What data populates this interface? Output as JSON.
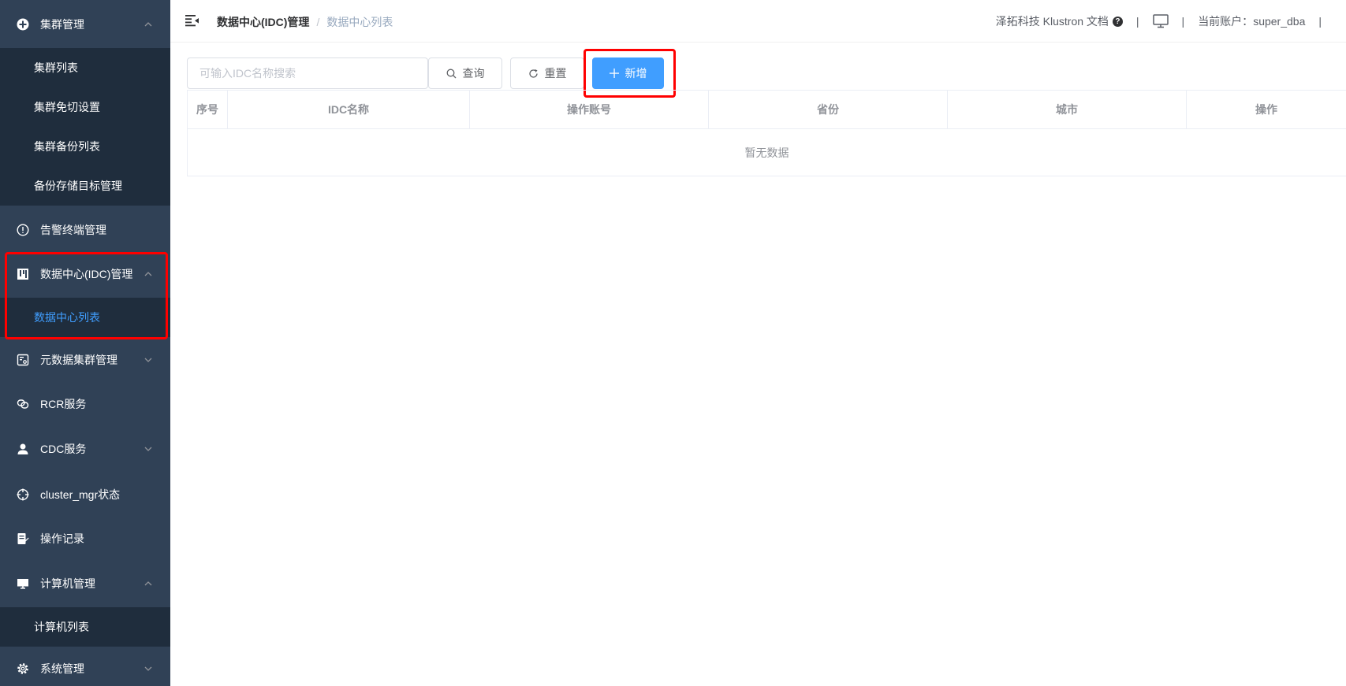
{
  "sidebar": {
    "items": [
      {
        "label": "集群管理",
        "icon": "plus-circle-icon",
        "expanded": true,
        "children": [
          "集群列表",
          "集群免切设置",
          "集群备份列表",
          "备份存储目标管理"
        ]
      },
      {
        "label": "告警终端管理",
        "icon": "alert-circle-icon"
      },
      {
        "label": "数据中心(IDC)管理",
        "icon": "datacenter-icon",
        "expanded": true,
        "children": [
          "数据中心列表"
        ],
        "active_child": "数据中心列表"
      },
      {
        "label": "元数据集群管理",
        "icon": "metadata-icon",
        "expanded": false
      },
      {
        "label": "RCR服务",
        "icon": "rcr-link-icon"
      },
      {
        "label": "CDC服务",
        "icon": "user-icon",
        "expanded": false
      },
      {
        "label": "cluster_mgr状态",
        "icon": "crosshair-icon"
      },
      {
        "label": "操作记录",
        "icon": "document-edit-icon"
      },
      {
        "label": "计算机管理",
        "icon": "monitor-icon",
        "expanded": true,
        "children": [
          "计算机列表"
        ]
      },
      {
        "label": "系统管理",
        "icon": "gear-icon",
        "expanded": false
      }
    ]
  },
  "header": {
    "breadcrumb": [
      "数据中心(IDC)管理",
      "数据中心列表"
    ],
    "docs_link": "泽拓科技 Klustron 文档",
    "account_label": "当前账户：",
    "account_name": "super_dba"
  },
  "toolbar": {
    "search_placeholder": "可输入IDC名称搜索",
    "search_value": "",
    "query_label": "查询",
    "reset_label": "重置",
    "add_label": "新增"
  },
  "table": {
    "columns": [
      "序号",
      "IDC名称",
      "操作账号",
      "省份",
      "城市",
      "操作"
    ],
    "empty_text": "暂无数据"
  },
  "colors": {
    "sidebar_bg": "#304156",
    "submenu_bg": "#1f2d3d",
    "active_text": "#409eff",
    "primary": "#409eff",
    "highlight_border": "#ff0000"
  }
}
